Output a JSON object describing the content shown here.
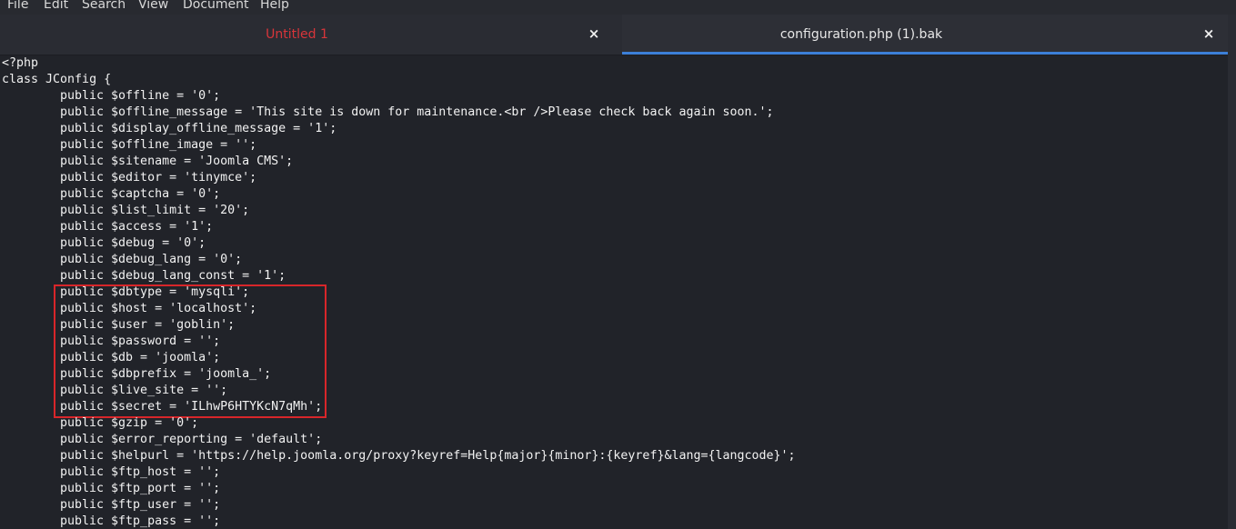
{
  "menubar": {
    "items": [
      "File",
      "Edit",
      "Search",
      "View",
      "Document",
      "Help"
    ]
  },
  "tabs": [
    {
      "label": "Untitled 1",
      "close": "×",
      "active": false,
      "label_color": "#d8353a"
    },
    {
      "label": "configuration.php (1).bak",
      "close": "×",
      "active": true,
      "accent": "#3c7fd8"
    }
  ],
  "editor": {
    "highlight_color": "#d8262a",
    "lines": [
      "<?php",
      "class JConfig {",
      "\tpublic $offline = '0';",
      "\tpublic $offline_message = 'This site is down for maintenance.<br />Please check back again soon.';",
      "\tpublic $display_offline_message = '1';",
      "\tpublic $offline_image = '';",
      "\tpublic $sitename = 'Joomla CMS';",
      "\tpublic $editor = 'tinymce';",
      "\tpublic $captcha = '0';",
      "\tpublic $list_limit = '20';",
      "\tpublic $access = '1';",
      "\tpublic $debug = '0';",
      "\tpublic $debug_lang = '0';",
      "\tpublic $debug_lang_const = '1';",
      "\tpublic $dbtype = 'mysqli';",
      "\tpublic $host = 'localhost';",
      "\tpublic $user = 'goblin';",
      "\tpublic $password = '';",
      "\tpublic $db = 'joomla';",
      "\tpublic $dbprefix = 'joomla_';",
      "\tpublic $live_site = '';",
      "\tpublic $secret = 'ILhwP6HTYKcN7qMh';",
      "\tpublic $gzip = '0';",
      "\tpublic $error_reporting = 'default';",
      "\tpublic $helpurl = 'https://help.joomla.org/proxy?keyref=Help{major}{minor}:{keyref}&lang={langcode}';",
      "\tpublic $ftp_host = '';",
      "\tpublic $ftp_port = '';",
      "\tpublic $ftp_user = '';",
      "\tpublic $ftp_pass = '';"
    ]
  }
}
